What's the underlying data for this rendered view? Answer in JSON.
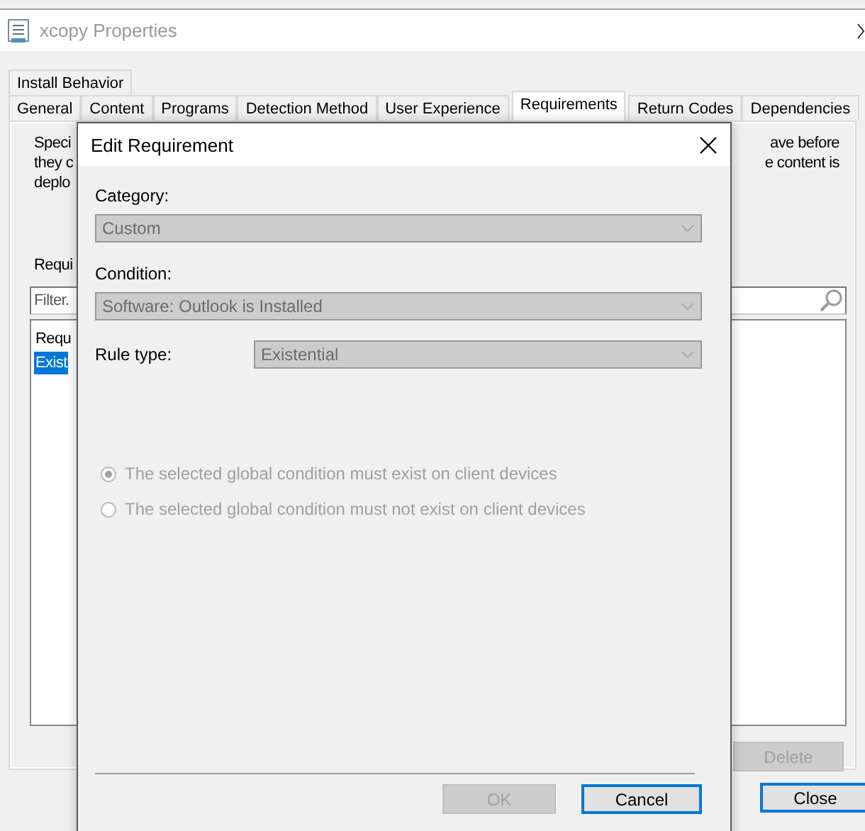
{
  "background_window": {
    "title": "xcopy Properties",
    "tab_rows": [
      [
        {
          "label": "Install Behavior",
          "selected": false
        }
      ],
      [
        {
          "label": "General",
          "selected": false
        },
        {
          "label": "Content",
          "selected": false
        },
        {
          "label": "Programs",
          "selected": false
        },
        {
          "label": "Detection Method",
          "selected": false
        },
        {
          "label": "User Experience",
          "selected": false
        },
        {
          "label": "Requirements",
          "selected": true
        },
        {
          "label": "Return Codes",
          "selected": false
        },
        {
          "label": "Dependencies",
          "selected": false
        }
      ]
    ],
    "description_left": [
      "Speci",
      "they c",
      "deplo"
    ],
    "description_right": [
      "ave before",
      "e content is"
    ],
    "list_label": "Requi",
    "filter": {
      "placeholder": "Filter."
    },
    "list": {
      "header": "Requ",
      "rows": [
        {
          "text": "Exist",
          "selected": true
        }
      ]
    },
    "delete_button": {
      "label": "Delete",
      "disabled": true
    },
    "close_button": {
      "label": "Close",
      "default": true
    }
  },
  "dialog": {
    "title": "Edit Requirement",
    "fields": [
      {
        "kind": "stacked",
        "label": "Category:",
        "value": "Custom",
        "disabled": true
      },
      {
        "kind": "stacked",
        "label": "Condition:",
        "value": "Software: Outlook is Installed",
        "disabled": true
      },
      {
        "kind": "inline",
        "label": "Rule type:",
        "value": "Existential",
        "disabled": true
      }
    ],
    "radios": [
      {
        "label": "The selected global condition must exist on client devices",
        "selected": true,
        "disabled": true
      },
      {
        "label": "The selected global condition must not exist on client devices",
        "selected": false,
        "disabled": true
      }
    ],
    "buttons": [
      {
        "label": "OK",
        "disabled": true,
        "default": false
      },
      {
        "label": "Cancel",
        "disabled": false,
        "default": true
      }
    ]
  }
}
